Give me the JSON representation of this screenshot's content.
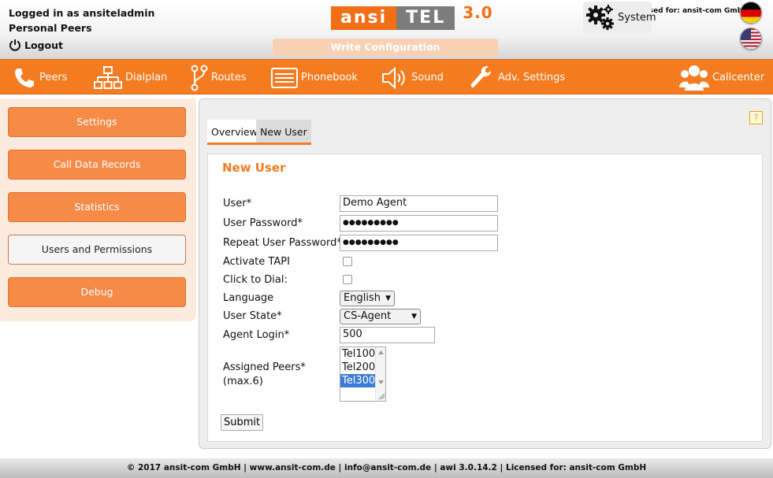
{
  "header": {
    "logged_in": "Logged in as ansiteladmin",
    "personal_peers": "Personal Peers",
    "logout": "Logout",
    "logo_ansi": "ansi",
    "logo_tel": "TEL",
    "logo_version": "3.0",
    "write_config": "Write Configuration",
    "licensed": "Licensed for: ansit-com GmbH"
  },
  "nav": [
    {
      "label": "Peers",
      "icon": "phone-icon"
    },
    {
      "label": "Dialplan",
      "icon": "sitemap-icon"
    },
    {
      "label": "Routes",
      "icon": "route-fork-icon"
    },
    {
      "label": "Phonebook",
      "icon": "phonebook-icon"
    },
    {
      "label": "Sound",
      "icon": "speaker-icon"
    },
    {
      "label": "Adv. Settings",
      "icon": "wrench-icon"
    },
    {
      "label": "System",
      "icon": "gears-icon",
      "active": true
    },
    {
      "label": "Callcenter",
      "icon": "users-icon"
    }
  ],
  "sidebar": {
    "items": [
      {
        "label": "Settings"
      },
      {
        "label": "Call Data Records"
      },
      {
        "label": "Statistics"
      },
      {
        "label": "Users and Permissions",
        "active": true
      },
      {
        "label": "Debug"
      }
    ]
  },
  "tabs": {
    "overview": "Overview",
    "new_user": "New User"
  },
  "form": {
    "title": "New User",
    "user_label": "User*",
    "user_value": "Demo Agent",
    "password_label": "User Password*",
    "password_value": "●●●●●●●●●",
    "repeat_label": "Repeat User Password*",
    "repeat_value": "●●●●●●●●●",
    "tapi_label": "Activate TAPI",
    "click_dial_label": "Click to Dial:",
    "language_label": "Language",
    "language_value": "English",
    "state_label": "User State*",
    "state_value": "CS-Agent",
    "agent_login_label": "Agent Login*",
    "agent_login_value": "500",
    "peers_label": "Assigned Peers*",
    "peers_max": "(max.6)",
    "peers": [
      "Tel100",
      "Tel200",
      "Tel300"
    ],
    "peers_selected": "Tel300",
    "submit": "Submit"
  },
  "help": "?",
  "footer": "© 2017 ansit-com GmbH | www.ansit-com.de | info@ansit-com.de | awi 3.0.14.2 | Licensed for: ansit-com GmbH",
  "colors": {
    "accent": "#f47b20",
    "sidebar_bg": "#fbebdf",
    "selected": "#3b7bd4"
  }
}
